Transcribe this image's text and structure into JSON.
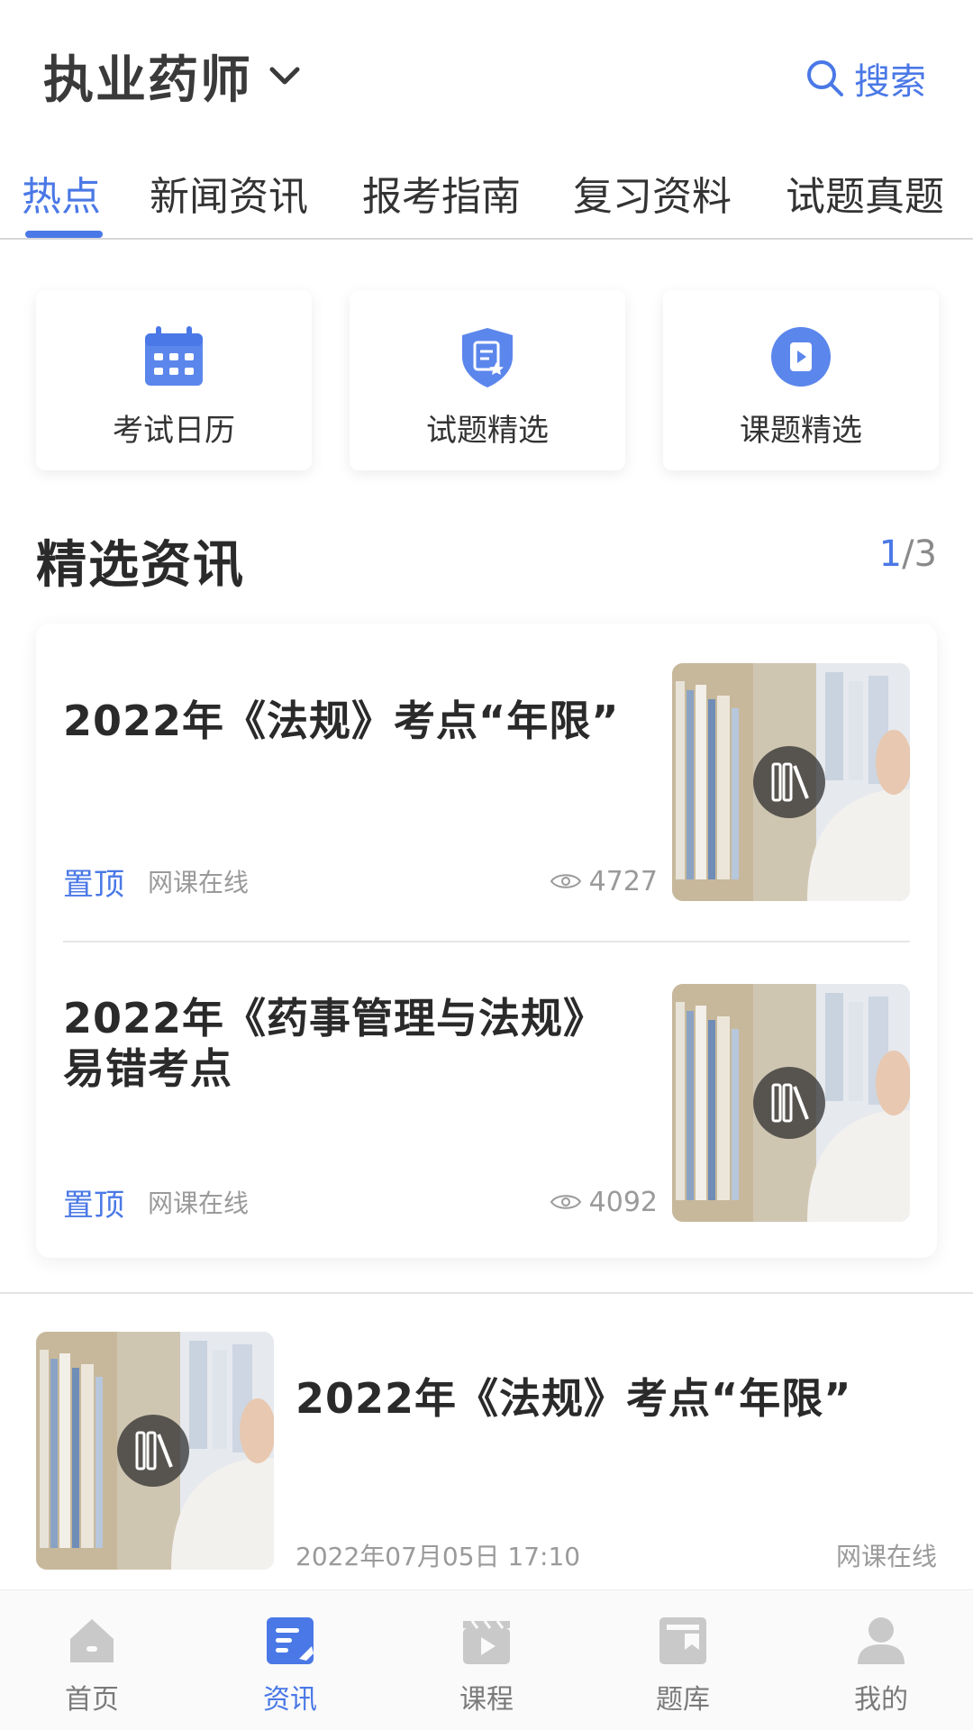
{
  "header": {
    "exam_title": "执业药师",
    "search_label": "搜索"
  },
  "tabs": [
    {
      "label": "热点",
      "active": true
    },
    {
      "label": "新闻资讯",
      "active": false
    },
    {
      "label": "报考指南",
      "active": false
    },
    {
      "label": "复习资料",
      "active": false
    },
    {
      "label": "试题真题",
      "active": false
    }
  ],
  "quick_links": [
    {
      "label": "考试日历",
      "icon": "calendar-icon"
    },
    {
      "label": "试题精选",
      "icon": "shield-exam-icon"
    },
    {
      "label": "课题精选",
      "icon": "video-play-icon"
    }
  ],
  "featured": {
    "title": "精选资讯",
    "pager_current": "1",
    "pager_total": "/3",
    "items": [
      {
        "title": "2022年《法规》考点“年限”",
        "pin": "置顶",
        "source": "网课在线",
        "views": "4727"
      },
      {
        "title": "2022年《药事管理与法规》易错考点",
        "pin": "置顶",
        "source": "网课在线",
        "views": "4092"
      }
    ]
  },
  "list": [
    {
      "title": "2022年《法规》考点“年限”",
      "date": "2022年07月05日 17:10",
      "source": "网课在线"
    }
  ],
  "bottom_nav": [
    {
      "label": "首页",
      "icon": "home-icon",
      "active": false
    },
    {
      "label": "资讯",
      "icon": "news-icon",
      "active": true
    },
    {
      "label": "课程",
      "icon": "course-icon",
      "active": false
    },
    {
      "label": "题库",
      "icon": "question-bank-icon",
      "active": false
    },
    {
      "label": "我的",
      "icon": "profile-icon",
      "active": false
    }
  ],
  "colors": {
    "accent": "#4a78e6",
    "text": "#2b2b2b",
    "muted": "#9a9a9a"
  }
}
